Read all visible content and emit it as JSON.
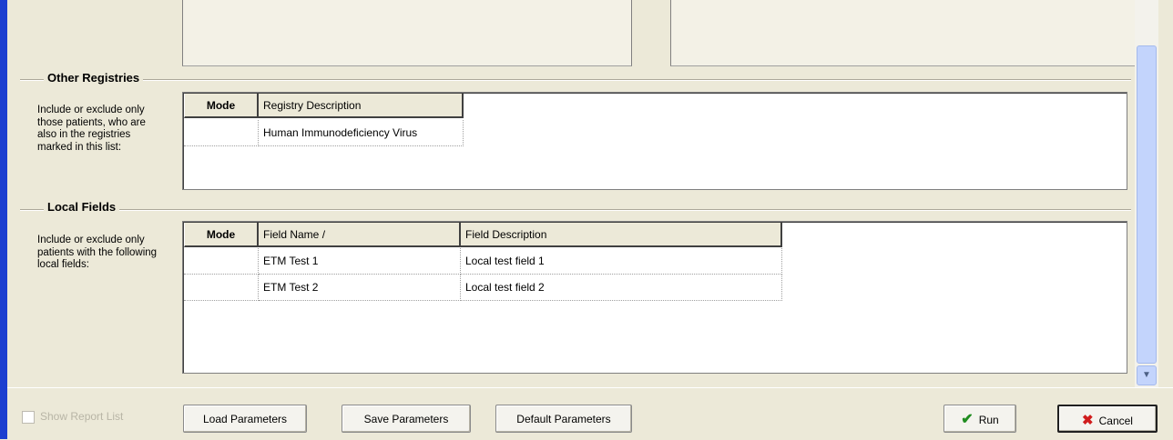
{
  "other_registries": {
    "title": "Other Registries",
    "description": "Include or exclude only those patients, who are also in the registries marked in this list:",
    "columns": [
      "Mode",
      "Registry Description"
    ],
    "rows": [
      {
        "mode": "",
        "description": "Human Immunodeficiency Virus"
      }
    ]
  },
  "local_fields": {
    "title": "Local Fields",
    "description": "Include or exclude only patients with the following local fields:",
    "columns": [
      "Mode",
      "Field Name /",
      "Field Description"
    ],
    "rows": [
      {
        "mode": "",
        "name": "ETM Test 1",
        "description": "Local test field 1"
      },
      {
        "mode": "",
        "name": "ETM Test 2",
        "description": "Local test field 2"
      }
    ]
  },
  "footer": {
    "show_report_list": "Show Report List",
    "show_report_list_checked": false,
    "load_parameters": "Load Parameters",
    "save_parameters": "Save Parameters",
    "default_parameters": "Default Parameters",
    "run": "Run",
    "cancel": "Cancel"
  },
  "icons": {
    "run": "checkmark-icon",
    "cancel": "x-icon",
    "scroll_down": "chevron-down-icon"
  }
}
